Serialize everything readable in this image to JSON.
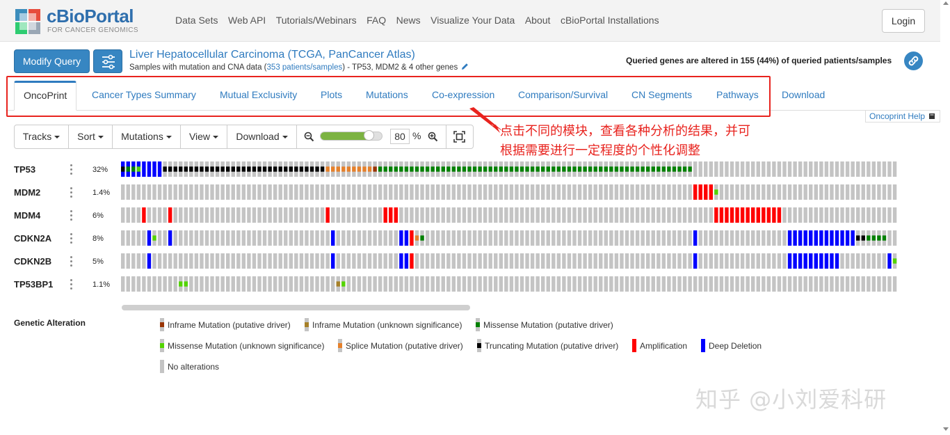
{
  "brand": {
    "name": "cBioPortal",
    "tagline": "FOR CANCER GENOMICS"
  },
  "nav": {
    "items": [
      "Data Sets",
      "Web API",
      "Tutorials/Webinars",
      "FAQ",
      "News",
      "Visualize Your Data",
      "About",
      "cBioPortal Installations"
    ],
    "login": "Login"
  },
  "query": {
    "modify_label": "Modify Query",
    "study_title": "Liver Hepatocellular Carcinoma (TCGA, PanCancer Atlas)",
    "subtitle_prefix": "Samples with mutation and CNA data (",
    "subtitle_link": "353 patients/samples",
    "subtitle_suffix": ")  - TP53, MDM2 & 4 other genes",
    "altered_summary": "Queried genes are altered in 155 (44%) of queried patients/samples"
  },
  "tabs": [
    "OncoPrint",
    "Cancer Types Summary",
    "Mutual Exclusivity",
    "Plots",
    "Mutations",
    "Co-expression",
    "Comparison/Survival",
    "CN Segments",
    "Pathways",
    "Download"
  ],
  "active_tab": "OncoPrint",
  "help_link": "Oncoprint Help",
  "toolbar": {
    "tracks": "Tracks",
    "sort": "Sort",
    "mutations": "Mutations",
    "view": "View",
    "download": "Download",
    "zoom_value": "80",
    "zoom_unit": "%",
    "zoom_slider_fraction": 0.8
  },
  "annotation": {
    "line1": "点击不同的模块，查看各种分析的结果，并可",
    "line2": "根据需要进行一定程度的个性化调整"
  },
  "genes": [
    {
      "name": "TP53",
      "pct": "32%"
    },
    {
      "name": "MDM2",
      "pct": "1.4%"
    },
    {
      "name": "MDM4",
      "pct": "6%"
    },
    {
      "name": "CDKN2A",
      "pct": "8%"
    },
    {
      "name": "CDKN2B",
      "pct": "5%"
    },
    {
      "name": "TP53BP1",
      "pct": "1.1%"
    }
  ],
  "legend": {
    "title": "Genetic Alteration",
    "items": [
      {
        "label": "Inframe Mutation (putative driver)",
        "color": "#993404"
      },
      {
        "label": "Inframe Mutation (unknown significance)",
        "color": "#a68028"
      },
      {
        "label": "Missense Mutation (putative driver)",
        "color": "#008000"
      },
      {
        "label": "Missense Mutation (unknown significance)",
        "color": "#53d400"
      },
      {
        "label": "Splice Mutation (putative driver)",
        "color": "#e5802b"
      },
      {
        "label": "Truncating Mutation (putative driver)",
        "color": "#000000"
      },
      {
        "label": "Amplification",
        "color": "#ff0000"
      },
      {
        "label": "Deep Deletion",
        "color": "#0000ff"
      },
      {
        "label": "No alterations",
        "color": "#c4c4c4"
      }
    ]
  },
  "watermark": "知乎 @小刘爱科研",
  "colors": {
    "accent": "#3786c2",
    "link": "#2f7bbf",
    "annotation": "#e8231e",
    "no_alteration": "#c4c4c4"
  }
}
